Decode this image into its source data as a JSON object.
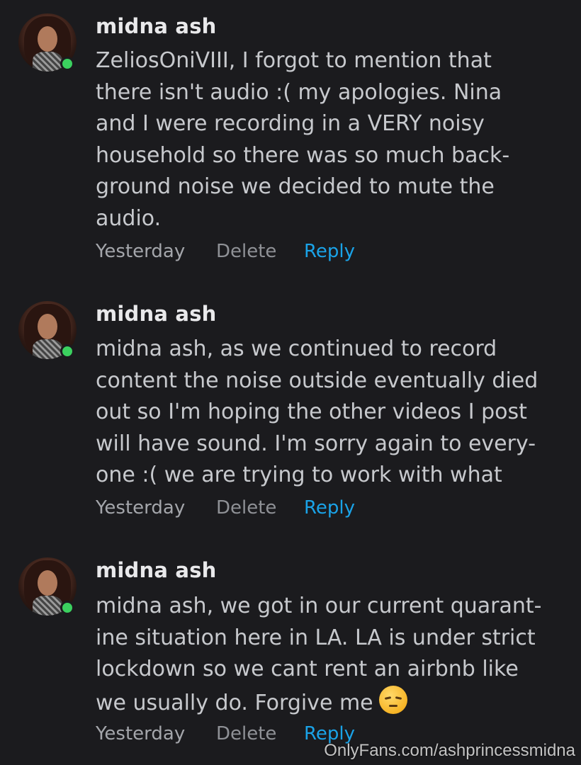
{
  "comments": [
    {
      "author": "midna ash",
      "text": "ZeliosOniVIII, I forgot to mention that\nthere isn't audio :( my apologies. Nina\nand I were recording in a VERY noisy\nhousehold so there was so much back-\nground noise we decided to mute the\naudio.",
      "time": "Yesterday",
      "delete_label": "Delete",
      "reply_label": "Reply",
      "online": true
    },
    {
      "author": "midna ash",
      "text": "midna ash, as we continued to record\ncontent the noise outside eventually died\nout so I'm hoping the other videos I post\nwill have sound. I'm sorry again to every-\none :( we are trying to work with what",
      "time": "Yesterday",
      "delete_label": "Delete",
      "reply_label": "Reply",
      "online": true
    },
    {
      "author": "midna ash",
      "text": "midna ash, we got in our current quarant-\nine situation here in LA. LA is under strict\nlockdown so we cant rent an airbnb like\nwe usually do. Forgive me",
      "emoji": "pensive-face-emoji",
      "time": "Yesterday",
      "delete_label": "Delete",
      "reply_label": "Reply",
      "online": true
    }
  ],
  "watermark": "OnlyFans.com/ashprincessmidna",
  "colors": {
    "background": "#1b1b1e",
    "reply_accent": "#1aa3e8",
    "online_green": "#3bd15f"
  }
}
